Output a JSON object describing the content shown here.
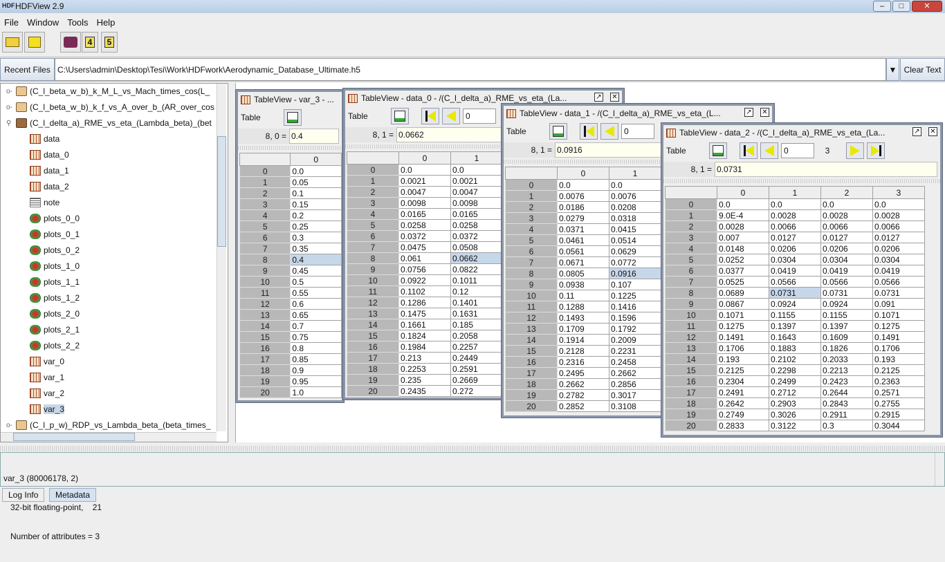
{
  "app": {
    "title": "HDFView 2.9",
    "logo": "HDF"
  },
  "menu": [
    "File",
    "Window",
    "Tools",
    "Help"
  ],
  "toolbar_icons": [
    "open-file-icon",
    "open-file-readonly-icon",
    "help-book-icon",
    "hdf4-library-icon",
    "hdf5-library-icon"
  ],
  "toolbar_badges": [
    "4",
    "5"
  ],
  "path": {
    "recent_label": "Recent Files",
    "value": "C:\\Users\\admin\\Desktop\\Tesi\\Work\\HDFwork\\Aerodynamic_Database_Ultimate.h5",
    "clear_label": "Clear Text"
  },
  "tree": [
    {
      "label": "(C_l_beta_w_b)_k_M_L_vs_Mach_times_cos(L_",
      "icon": "folder-closed",
      "level": 0
    },
    {
      "label": "(C_l_beta_w_b)_k_f_vs_A_over_b_(AR_over_cos",
      "icon": "folder-closed",
      "level": 0
    },
    {
      "label": "(C_l_delta_a)_RME_vs_eta_(Lambda_beta)_(bet",
      "icon": "folder-open",
      "level": 0
    },
    {
      "label": "data",
      "icon": "dataset",
      "level": 1
    },
    {
      "label": "data_0",
      "icon": "dataset",
      "level": 1
    },
    {
      "label": "data_1",
      "icon": "dataset",
      "level": 1
    },
    {
      "label": "data_2",
      "icon": "dataset",
      "level": 1
    },
    {
      "label": "note",
      "icon": "text",
      "level": 1
    },
    {
      "label": "plots_0_0",
      "icon": "image",
      "level": 1
    },
    {
      "label": "plots_0_1",
      "icon": "image",
      "level": 1
    },
    {
      "label": "plots_0_2",
      "icon": "image",
      "level": 1
    },
    {
      "label": "plots_1_0",
      "icon": "image",
      "level": 1
    },
    {
      "label": "plots_1_1",
      "icon": "image",
      "level": 1
    },
    {
      "label": "plots_1_2",
      "icon": "image",
      "level": 1
    },
    {
      "label": "plots_2_0",
      "icon": "image",
      "level": 1
    },
    {
      "label": "plots_2_1",
      "icon": "image",
      "level": 1
    },
    {
      "label": "plots_2_2",
      "icon": "image",
      "level": 1
    },
    {
      "label": "var_0",
      "icon": "dataset",
      "level": 1
    },
    {
      "label": "var_1",
      "icon": "dataset",
      "level": 1
    },
    {
      "label": "var_2",
      "icon": "dataset",
      "level": 1
    },
    {
      "label": "var_3",
      "icon": "dataset",
      "level": 1,
      "selected": true
    },
    {
      "label": "(C_l_p_w)_RDP_vs_Lambda_beta_(beta_times_",
      "icon": "folder-closed",
      "level": 0
    }
  ],
  "windows": [
    {
      "id": "var3",
      "title": "TableView  -  var_3  - ...",
      "menu": "Table",
      "nav": false,
      "cell_ref": "8, 0  =",
      "cell_value": "0.4",
      "selected": [
        8,
        0
      ],
      "columns": [
        "0"
      ],
      "rows": [
        [
          "0.0"
        ],
        [
          "0.05"
        ],
        [
          "0.1"
        ],
        [
          "0.15"
        ],
        [
          "0.2"
        ],
        [
          "0.25"
        ],
        [
          "0.3"
        ],
        [
          "0.35"
        ],
        [
          "0.4"
        ],
        [
          "0.45"
        ],
        [
          "0.5"
        ],
        [
          "0.55"
        ],
        [
          "0.6"
        ],
        [
          "0.65"
        ],
        [
          "0.7"
        ],
        [
          "0.75"
        ],
        [
          "0.8"
        ],
        [
          "0.85"
        ],
        [
          "0.9"
        ],
        [
          "0.95"
        ],
        [
          "1.0"
        ]
      ]
    },
    {
      "id": "data0",
      "title": "TableView  -  data_0  -  /(C_l_delta_a)_RME_vs_eta_(La...",
      "menu": "Table",
      "nav": true,
      "page": "0",
      "cell_ref": "8, 1  =",
      "cell_value": "0.0662",
      "selected": [
        8,
        1
      ],
      "columns": [
        "0",
        "1"
      ],
      "rows": [
        [
          "0.0",
          "0.0"
        ],
        [
          "0.0021",
          "0.0021"
        ],
        [
          "0.0047",
          "0.0047"
        ],
        [
          "0.0098",
          "0.0098"
        ],
        [
          "0.0165",
          "0.0165"
        ],
        [
          "0.0258",
          "0.0258"
        ],
        [
          "0.0372",
          "0.0372"
        ],
        [
          "0.0475",
          "0.0508"
        ],
        [
          "0.061",
          "0.0662"
        ],
        [
          "0.0756",
          "0.0822"
        ],
        [
          "0.0922",
          "0.1011"
        ],
        [
          "0.1102",
          "0.12"
        ],
        [
          "0.1286",
          "0.1401"
        ],
        [
          "0.1475",
          "0.1631"
        ],
        [
          "0.1661",
          "0.185"
        ],
        [
          "0.1824",
          "0.2058"
        ],
        [
          "0.1984",
          "0.2257"
        ],
        [
          "0.213",
          "0.2449"
        ],
        [
          "0.2253",
          "0.2591"
        ],
        [
          "0.235",
          "0.2669"
        ],
        [
          "0.2435",
          "0.272"
        ]
      ]
    },
    {
      "id": "data1",
      "title": "TableView  -  data_1  -  /(C_l_delta_a)_RME_vs_eta_(L...",
      "menu": "Table",
      "nav": true,
      "page": "0",
      "cell_ref": "8, 1  =",
      "cell_value": "0.0916",
      "selected": [
        8,
        1
      ],
      "columns": [
        "0",
        "1"
      ],
      "rows": [
        [
          "0.0",
          "0.0"
        ],
        [
          "0.0076",
          "0.0076"
        ],
        [
          "0.0186",
          "0.0208"
        ],
        [
          "0.0279",
          "0.0318"
        ],
        [
          "0.0371",
          "0.0415"
        ],
        [
          "0.0461",
          "0.0514"
        ],
        [
          "0.0561",
          "0.0629"
        ],
        [
          "0.0671",
          "0.0772"
        ],
        [
          "0.0805",
          "0.0916"
        ],
        [
          "0.0938",
          "0.107"
        ],
        [
          "0.11",
          "0.1225"
        ],
        [
          "0.1288",
          "0.1416"
        ],
        [
          "0.1493",
          "0.1596"
        ],
        [
          "0.1709",
          "0.1792"
        ],
        [
          "0.1914",
          "0.2009"
        ],
        [
          "0.2128",
          "0.2231"
        ],
        [
          "0.2316",
          "0.2458"
        ],
        [
          "0.2495",
          "0.2662"
        ],
        [
          "0.2662",
          "0.2856"
        ],
        [
          "0.2782",
          "0.3017"
        ],
        [
          "0.2852",
          "0.3108"
        ]
      ]
    },
    {
      "id": "data2",
      "title": "TableView  -  data_2  -  /(C_l_delta_a)_RME_vs_eta_(La...",
      "menu": "Table",
      "nav": true,
      "page": "0",
      "max_page": "3",
      "next": true,
      "cell_ref": "8, 1  =",
      "cell_value": "0.0731",
      "selected": [
        8,
        1
      ],
      "columns": [
        "0",
        "1",
        "2",
        "3"
      ],
      "rows": [
        [
          "0.0",
          "0.0",
          "0.0",
          "0.0"
        ],
        [
          "9.0E-4",
          "0.0028",
          "0.0028",
          "0.0028"
        ],
        [
          "0.0028",
          "0.0066",
          "0.0066",
          "0.0066"
        ],
        [
          "0.007",
          "0.0127",
          "0.0127",
          "0.0127"
        ],
        [
          "0.0148",
          "0.0206",
          "0.0206",
          "0.0206"
        ],
        [
          "0.0252",
          "0.0304",
          "0.0304",
          "0.0304"
        ],
        [
          "0.0377",
          "0.0419",
          "0.0419",
          "0.0419"
        ],
        [
          "0.0525",
          "0.0566",
          "0.0566",
          "0.0566"
        ],
        [
          "0.0689",
          "0.0731",
          "0.0731",
          "0.0731"
        ],
        [
          "0.0867",
          "0.0924",
          "0.0924",
          "0.091"
        ],
        [
          "0.1071",
          "0.1155",
          "0.1155",
          "0.1071"
        ],
        [
          "0.1275",
          "0.1397",
          "0.1397",
          "0.1275"
        ],
        [
          "0.1491",
          "0.1643",
          "0.1609",
          "0.1491"
        ],
        [
          "0.1706",
          "0.1883",
          "0.1826",
          "0.1706"
        ],
        [
          "0.193",
          "0.2102",
          "0.2033",
          "0.193"
        ],
        [
          "0.2125",
          "0.2298",
          "0.2213",
          "0.2125"
        ],
        [
          "0.2304",
          "0.2499",
          "0.2423",
          "0.2363"
        ],
        [
          "0.2491",
          "0.2712",
          "0.2644",
          "0.2571"
        ],
        [
          "0.2642",
          "0.2903",
          "0.2843",
          "0.2755"
        ],
        [
          "0.2749",
          "0.3026",
          "0.2911",
          "0.2915"
        ],
        [
          "0.2833",
          "0.3122",
          "0.3",
          "0.3044"
        ]
      ]
    }
  ],
  "info": {
    "lines": [
      "var_3 (80006178, 2)",
      "   32-bit floating-point,    21",
      "   Number of attributes = 3"
    ]
  },
  "tabs": [
    "Log Info",
    "Metadata"
  ],
  "colors": {
    "selection": "#c7d7ea",
    "row_header": "#b8b8b8",
    "cell_field": "#fffff0",
    "arrow": "#e8e800"
  }
}
